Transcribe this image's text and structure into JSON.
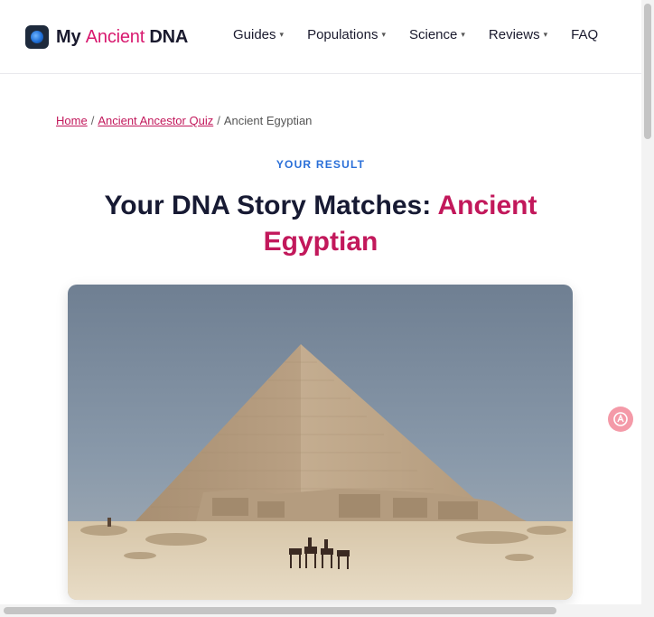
{
  "header": {
    "logo": {
      "part1": "My",
      "part2": "Ancient",
      "part3": "DNA"
    },
    "nav": [
      {
        "label": "Guides",
        "caret": "▾"
      },
      {
        "label": "Populations",
        "caret": "▾"
      },
      {
        "label": "Science",
        "caret": "▾"
      },
      {
        "label": "Reviews",
        "caret": "▾"
      },
      {
        "label": "FAQ"
      }
    ]
  },
  "breadcrumb": {
    "items": [
      "Home",
      "Ancient Ancestor Quiz",
      "Ancient Egyptian"
    ],
    "separator": "/"
  },
  "result": {
    "eyebrow": "YOUR RESULT",
    "title_prefix": "Your DNA Story Matches:",
    "title_highlight": "Ancient Egyptian"
  },
  "hero_image": {
    "subject": "Great Pyramid of Giza with camel riders in the desert"
  },
  "icons": {
    "logo": "dna-globe-icon",
    "translate": "translate-icon"
  },
  "colors": {
    "accent": "#d8196f",
    "link": "#c2185b",
    "eyebrow": "#2a6fd8",
    "title": "#171a33",
    "translate_button": "#f49aa8"
  }
}
